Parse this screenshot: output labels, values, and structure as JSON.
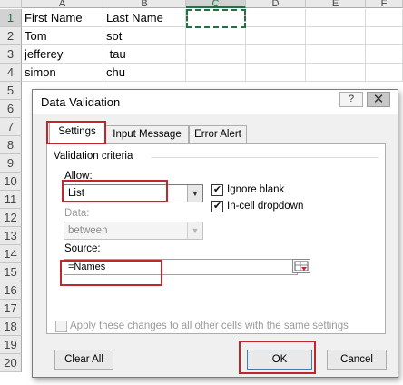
{
  "sheet": {
    "columns": [
      "A",
      "B",
      "C",
      "D",
      "E",
      "F"
    ],
    "selected_column": "C",
    "rows": [
      "1",
      "2",
      "3",
      "4",
      "5",
      "6",
      "7",
      "8",
      "9",
      "10",
      "11",
      "12",
      "13",
      "14",
      "15",
      "16",
      "17",
      "18",
      "19",
      "20"
    ],
    "cells": {
      "A1": "First Name",
      "B1": "Last Name",
      "A2": "Tom",
      "B2": "sot",
      "A3": "jefferey",
      "B3": " tau",
      "A4": "simon",
      "B4": "chu"
    }
  },
  "dialog": {
    "title": "Data Validation",
    "help_button": "?",
    "close_button": "✕",
    "tabs": [
      "Settings",
      "Input Message",
      "Error Alert"
    ],
    "active_tab": "Settings",
    "group_label": "Validation criteria",
    "allow_label": "Allow:",
    "allow_value": "List",
    "data_label": "Data:",
    "data_value": "between",
    "ignore_blank_label": "Ignore blank",
    "ignore_blank_checked": true,
    "in_cell_dropdown_label": "In-cell dropdown",
    "in_cell_dropdown_checked": true,
    "source_label": "Source:",
    "source_value": "=Names",
    "apply_all_label": "Apply these changes to all other cells with the same settings",
    "clear_all_label": "Clear All",
    "ok_label": "OK",
    "cancel_label": "Cancel"
  },
  "colors": {
    "highlight_box": "#c0272d",
    "excel_green": "#217346"
  }
}
